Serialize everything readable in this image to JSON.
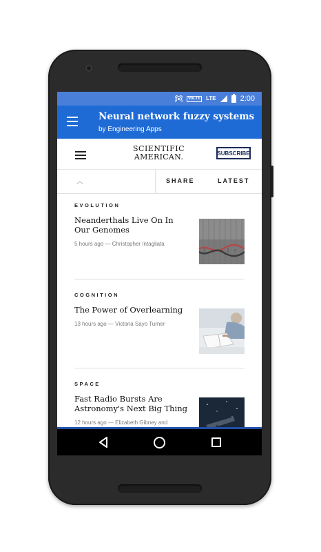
{
  "status_bar": {
    "network": "VoLTE",
    "signal": "LTE",
    "time": "2:00"
  },
  "app_bar": {
    "title": "Neural network fuzzy systems",
    "subtitle": "by Engineering Apps"
  },
  "site_header": {
    "logo_line1": "SCIENTIFIC",
    "logo_line2": "AMERICAN.",
    "subscribe_label": "SUBSCRIBE"
  },
  "toolbar": {
    "share_label": "SHARE",
    "latest_label": "LATEST"
  },
  "articles": [
    {
      "category": "EVOLUTION",
      "headline": "Neanderthals Live On In Our Genomes",
      "meta": "5 hours ago — Christopher Intagliata",
      "thumb": "dna-image"
    },
    {
      "category": "COGNITION",
      "headline": "The Power of Overlearning",
      "meta": "13 hours ago — Victoria Sayo Turner",
      "thumb": "reading-image"
    },
    {
      "category": "SPACE",
      "headline": "Fast Radio Bursts Are Astronomy's Next Big Thing",
      "meta": "12 hours ago — Elizabeth Gibney and",
      "thumb": "telescope-image"
    }
  ],
  "colors": {
    "status_bar": "#4a7fd9",
    "app_bar": "#1f6bd6",
    "subscribe_border": "#1a2a5a"
  }
}
